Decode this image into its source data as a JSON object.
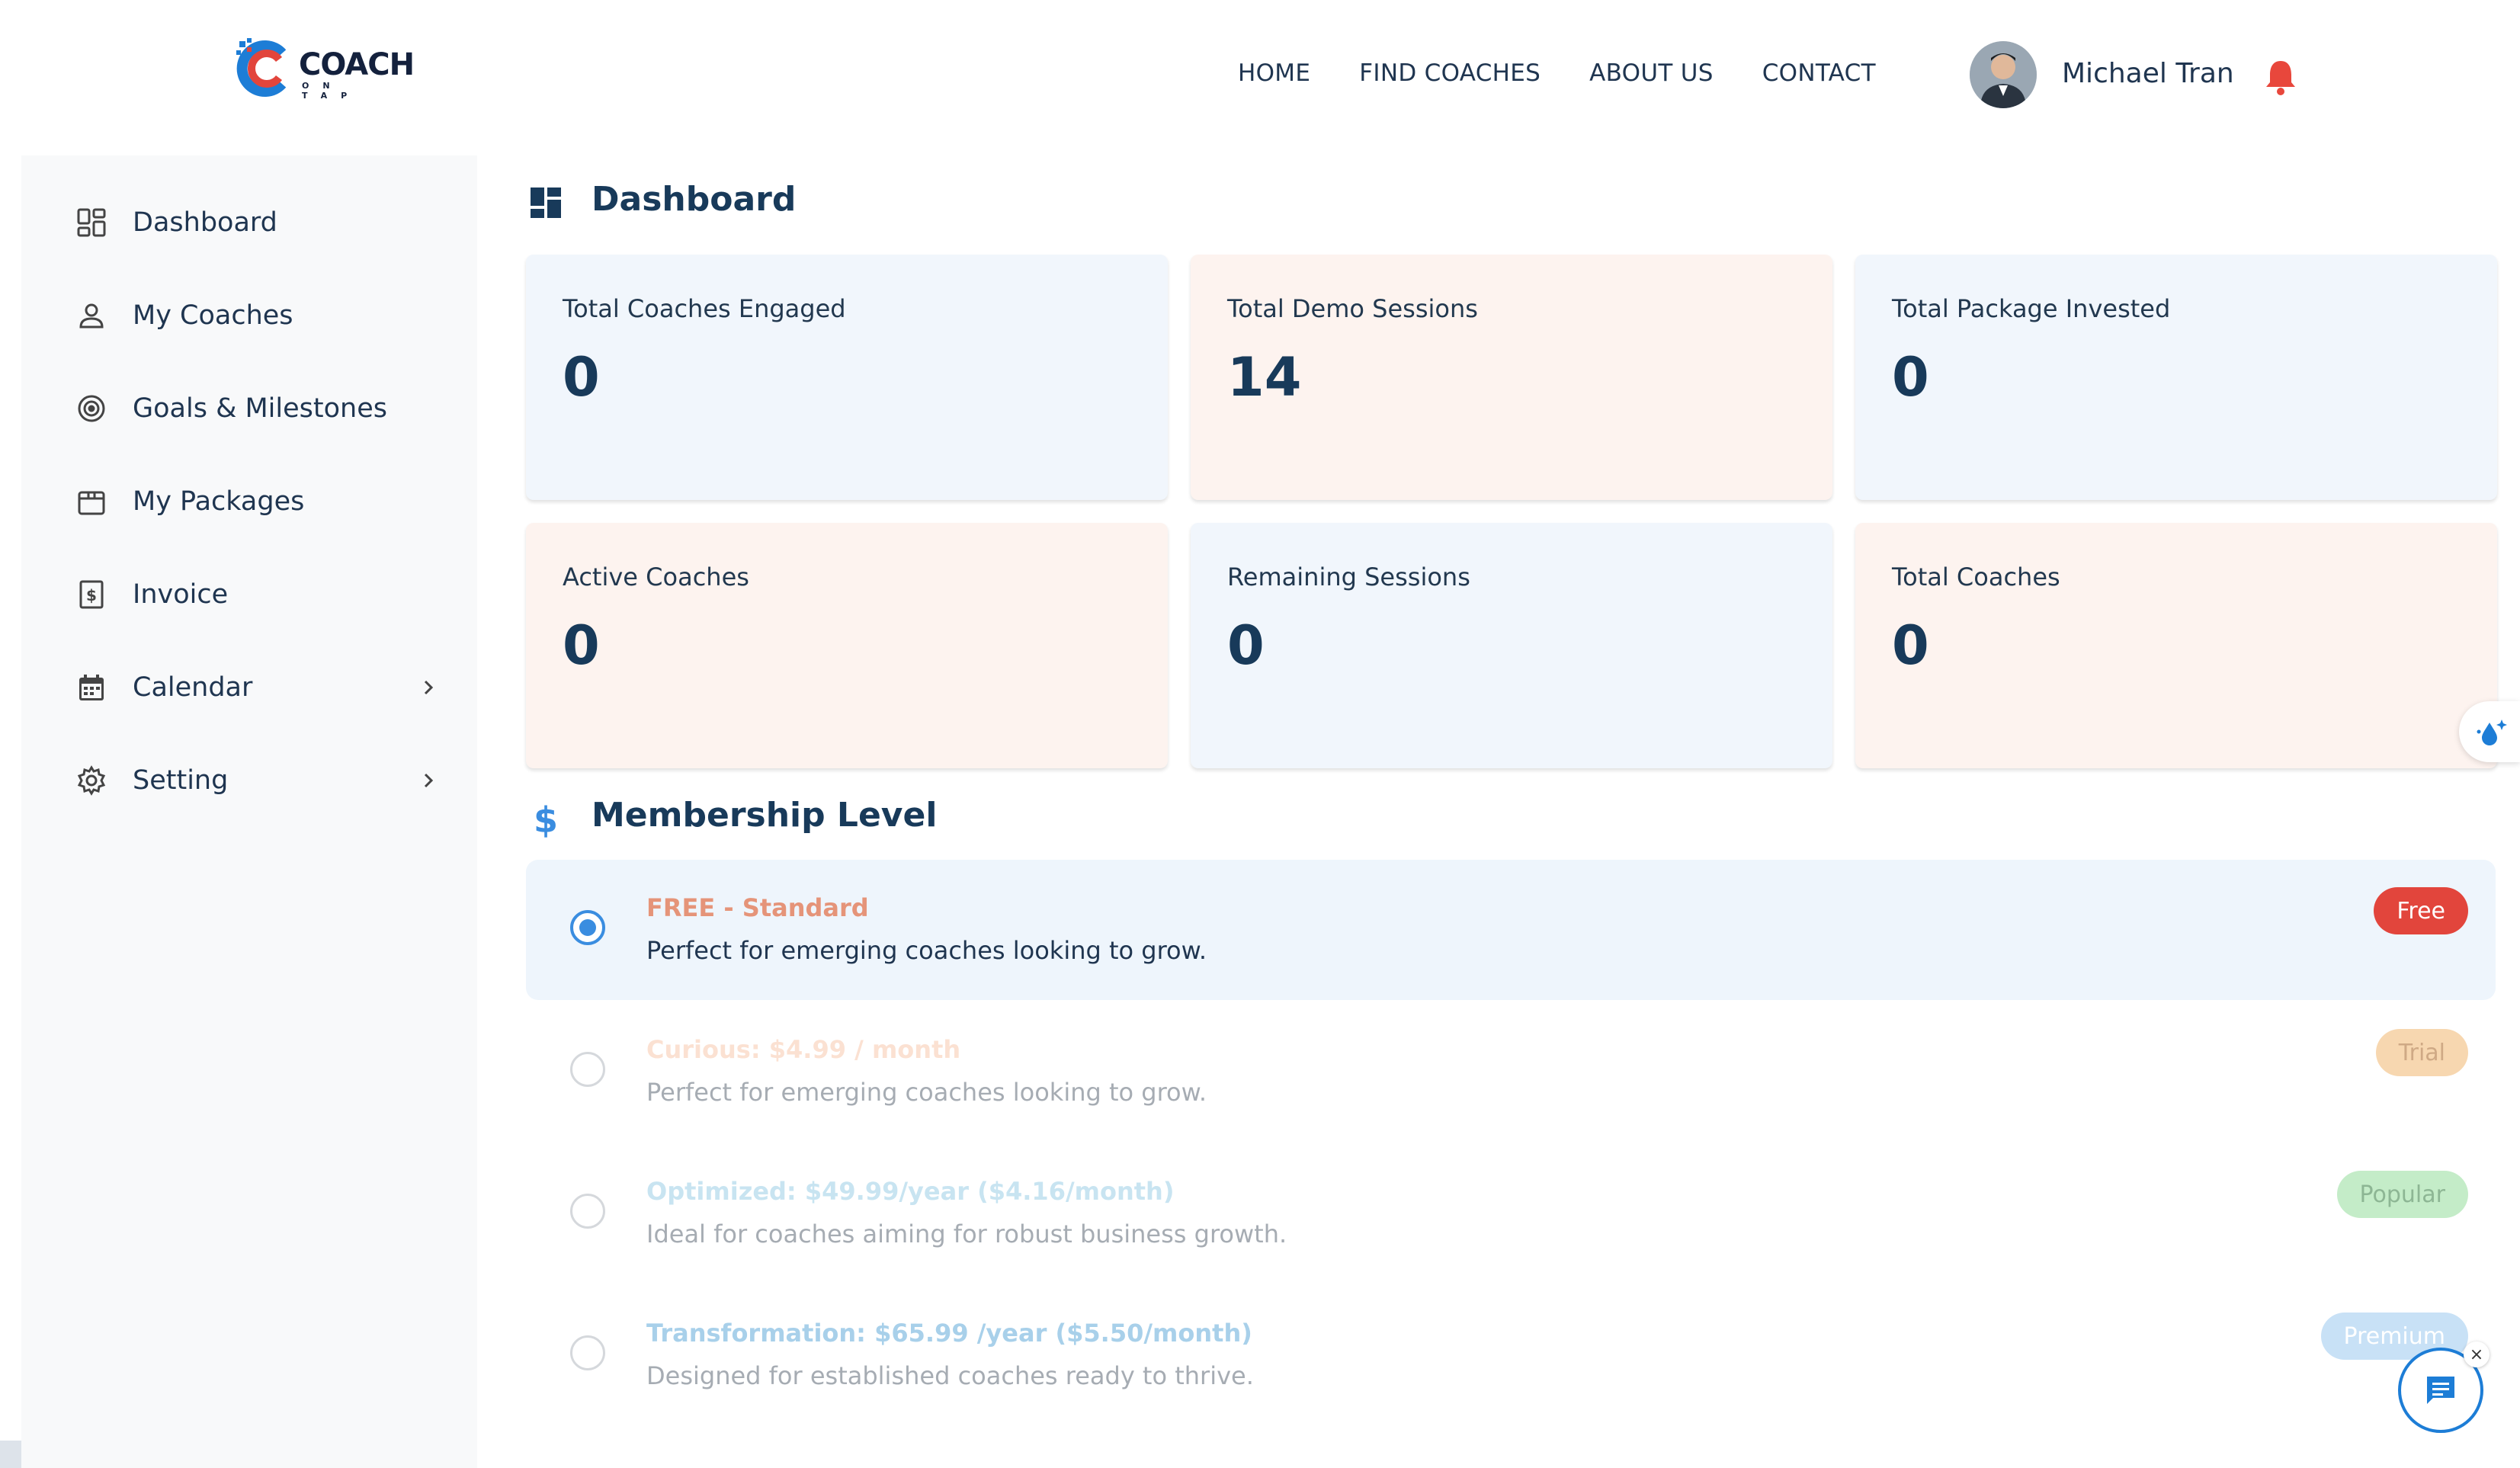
{
  "brand": {
    "logo_text": "COACH",
    "logo_sub": "ON TAP"
  },
  "nav": {
    "items": [
      "HOME",
      "FIND COACHES",
      "ABOUT US",
      "CONTACT"
    ]
  },
  "user": {
    "name": "Michael Tran"
  },
  "sidebar": {
    "items": [
      {
        "label": "Dashboard",
        "icon": "dashboard-grid-icon"
      },
      {
        "label": "My Coaches",
        "icon": "person-icon"
      },
      {
        "label": "Goals & Milestones",
        "icon": "target-icon"
      },
      {
        "label": "My Packages",
        "icon": "package-icon"
      },
      {
        "label": "Invoice",
        "icon": "invoice-dollar-icon"
      },
      {
        "label": "Calendar",
        "icon": "calendar-icon"
      },
      {
        "label": "Setting",
        "icon": "gear-icon"
      }
    ]
  },
  "dashboard": {
    "title": "Dashboard",
    "cards": [
      {
        "label": "Total Coaches Engaged",
        "value": "0"
      },
      {
        "label": "Total Demo Sessions",
        "value": "14"
      },
      {
        "label": "Total Package Invested",
        "value": "0"
      },
      {
        "label": "Active Coaches",
        "value": "0"
      },
      {
        "label": "Remaining Sessions",
        "value": "0"
      },
      {
        "label": "Total Coaches",
        "value": "0"
      }
    ]
  },
  "membership": {
    "title": "Membership Level",
    "plans": [
      {
        "title": "FREE - Standard",
        "desc": "Perfect for emerging coaches looking to grow.",
        "badge": "Free",
        "selected": true
      },
      {
        "title": "Curious: $4.99 / month",
        "desc": "Perfect for emerging coaches looking to grow.",
        "badge": "Trial",
        "selected": false
      },
      {
        "title": "Optimized: $49.99/year ($4.16/month)",
        "desc": "Ideal for coaches aiming for robust business growth.",
        "badge": "Popular",
        "selected": false
      },
      {
        "title": "Transformation: $65.99 /year ($5.50/month)",
        "desc": "Designed for established coaches ready to thrive.",
        "badge": "Premium",
        "selected": false
      }
    ]
  },
  "colors": {
    "accent": "#3a8de0",
    "primary_text": "#183a5a",
    "badge_free": "#e2453c",
    "badge_trial": "#f7d7b0",
    "badge_popular": "#c4ecc8",
    "badge_premium": "#c8e1f6",
    "bell": "#e8473c"
  }
}
